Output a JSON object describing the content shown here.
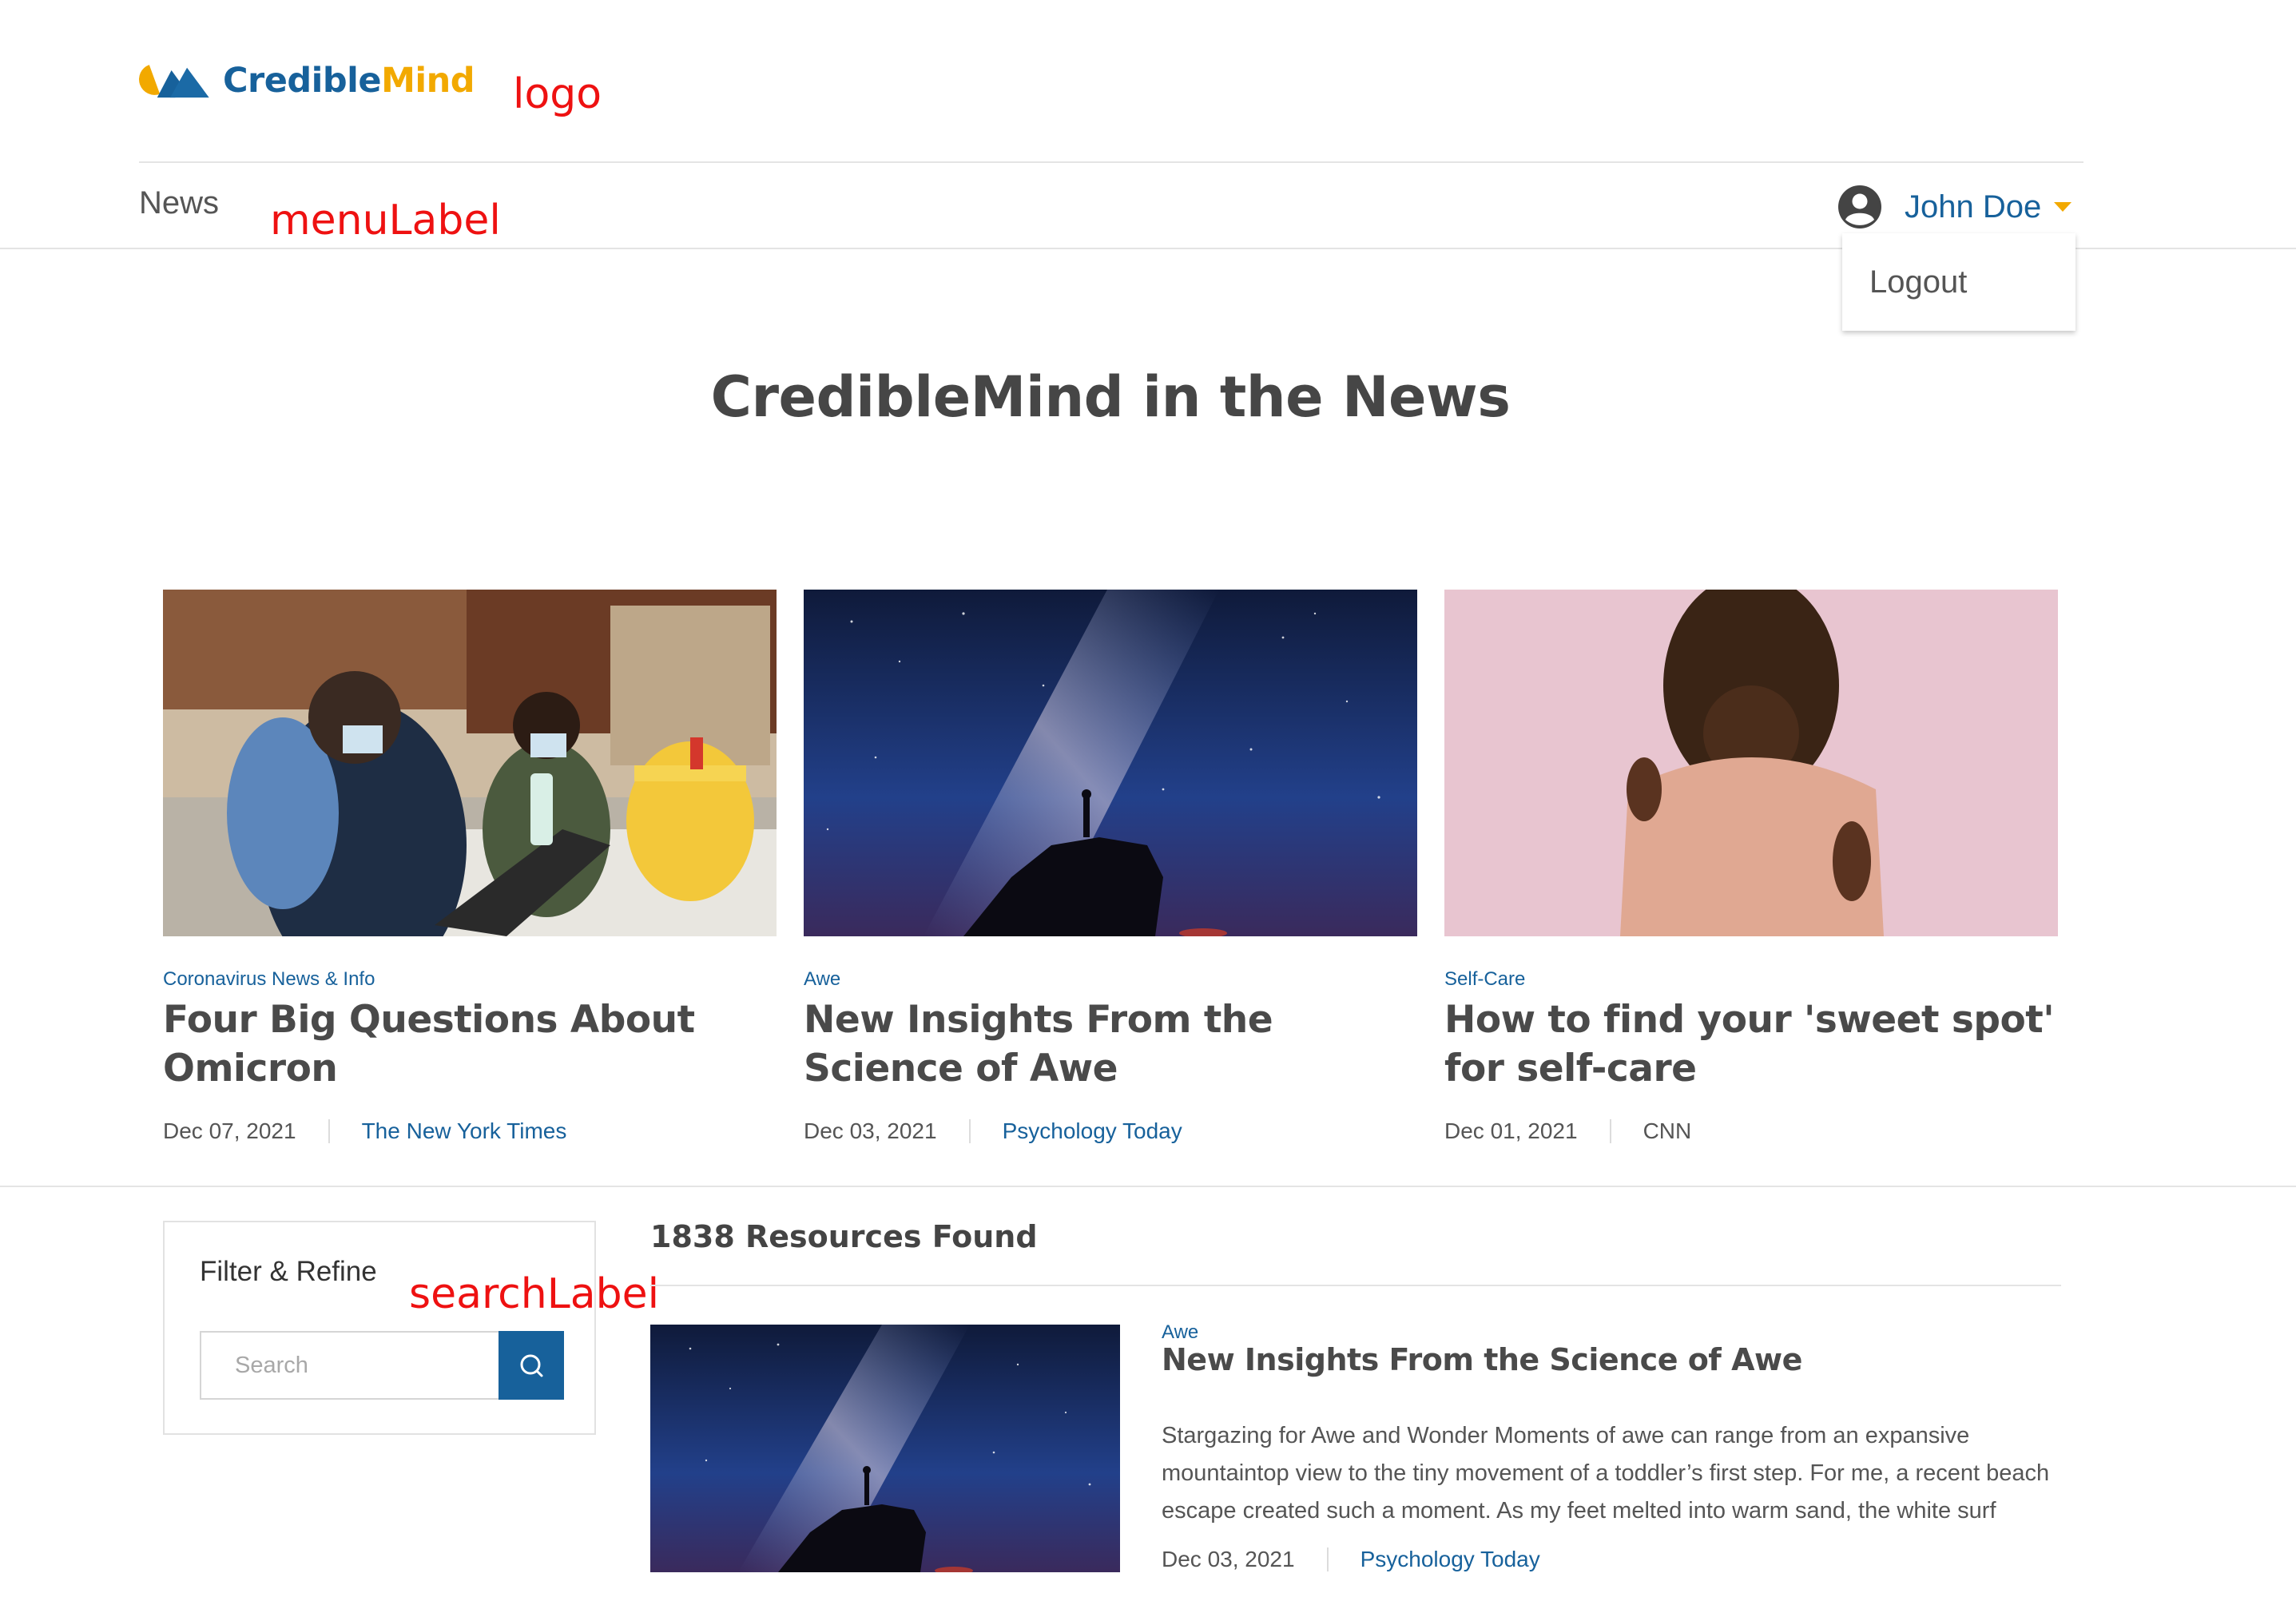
{
  "header": {
    "logo_text_part1": "Credible",
    "logo_text_part2": "Mind",
    "nav_item": "News",
    "user_name": "John Doe",
    "dropdown_item": "Logout"
  },
  "annotations": {
    "logo": "logo",
    "menu": "menuLabel",
    "search": "searchLabel"
  },
  "page_title": "CredibleMind in the News",
  "featured": [
    {
      "category": "Coronavirus News & Info",
      "title": "Four Big Questions About Omicron",
      "date": "Dec 07, 2021",
      "source": "The New York Times"
    },
    {
      "category": "Awe",
      "title": "New Insights From the Science of Awe",
      "date": "Dec 03, 2021",
      "source": "Psychology Today"
    },
    {
      "category": "Self-Care",
      "title": "How to find your 'sweet spot' for self-care",
      "date": "Dec 01, 2021",
      "source": "CNN"
    }
  ],
  "filter": {
    "title": "Filter & Refine",
    "search_placeholder": "Search",
    "search_value": ""
  },
  "results": {
    "count_label": "1838 Resources Found",
    "items": [
      {
        "category": "Awe",
        "title": "New Insights From the Science of Awe",
        "excerpt": "Stargazing for Awe and Wonder Moments of awe can range from an expansive mountaintop view to the tiny movement of a toddler’s first step. For me, a recent beach escape created such a moment. As my feet melted into warm sand, the white surf flow…",
        "date": "Dec 03, 2021",
        "source": "Psychology Today"
      }
    ]
  },
  "colors": {
    "brand_blue": "#17619b",
    "brand_yellow": "#f2a900",
    "annotation_red": "#ee1111",
    "title_gray": "#4a4a4a"
  },
  "icons": {
    "user": "account-circle-icon",
    "caret": "caret-down-icon",
    "search": "search-icon"
  }
}
